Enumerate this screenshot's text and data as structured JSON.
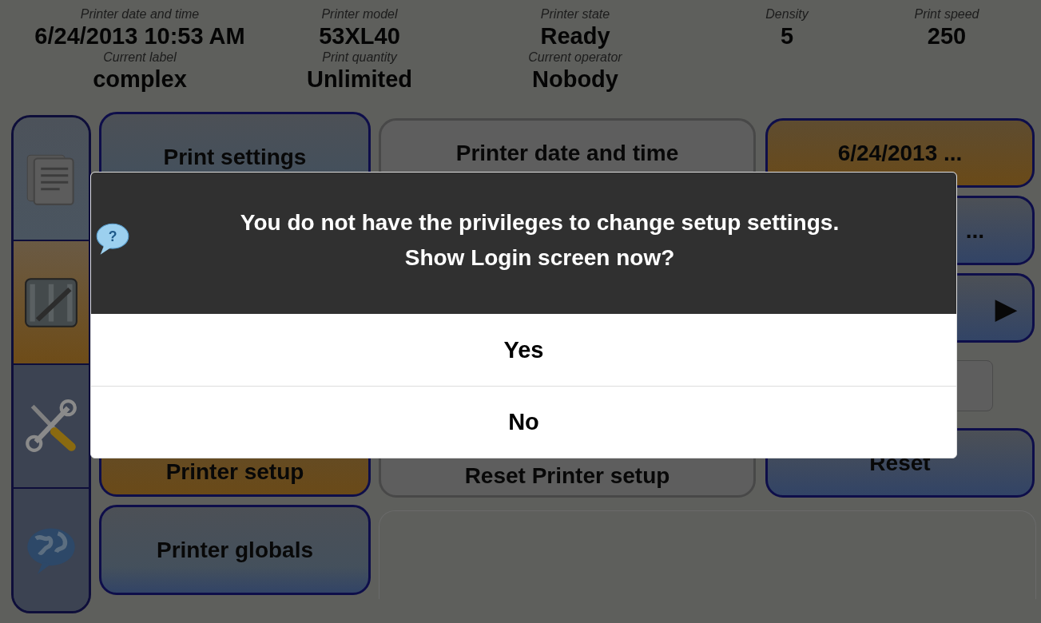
{
  "status_fields": [
    {
      "label": "Printer date and time",
      "value": "6/24/2013 10:53 AM"
    },
    {
      "label": "Printer model",
      "value": "53XL40"
    },
    {
      "label": "Printer state",
      "value": "Ready"
    },
    {
      "label": "Density",
      "value": "5"
    },
    {
      "label": "Print speed",
      "value": "250"
    },
    {
      "label": "Current label",
      "value": "complex"
    },
    {
      "label": "Print quantity",
      "value": "Unlimited"
    },
    {
      "label": "Current operator",
      "value": "Nobody"
    }
  ],
  "sidebar": {
    "items": [
      {
        "kind": "notes",
        "selected": false
      },
      {
        "kind": "edit",
        "selected": true
      },
      {
        "kind": "tools",
        "selected": false
      },
      {
        "kind": "globe",
        "selected": false
      }
    ]
  },
  "menu": [
    {
      "label": "Print settings",
      "selected": false
    },
    {
      "label": "Printer setup",
      "selected": true
    },
    {
      "label": "Printer globals",
      "selected": false
    }
  ],
  "settings": {
    "date_label": "Printer date and time",
    "date_value": "6/24/2013 ...",
    "second_value": "...",
    "next_arrow": "▶",
    "reset_label": "Reset Printer setup",
    "reset_button": "Reset"
  },
  "dialog": {
    "icon_glyph": "?",
    "message_lines": [
      "You do not have the privileges to change setup settings.",
      "Show Login screen now?"
    ],
    "buttons": [
      "Yes",
      "No"
    ]
  }
}
